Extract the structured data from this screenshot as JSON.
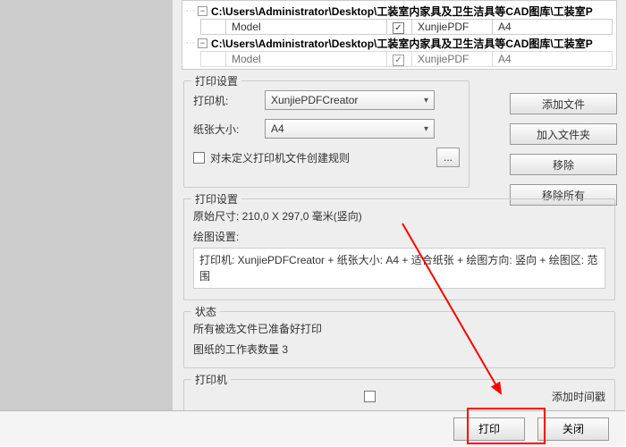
{
  "tree": {
    "path1": "C:\\Users\\Administrator\\Desktop\\工装室内家具及卫生洁具等CAD图库\\工装室P",
    "model": "Model",
    "pdfcol": "XunjiePDF",
    "paper": "A4",
    "path2": "C:\\Users\\Administrator\\Desktop\\工装室内家具及卫生洁具等CAD图库\\工装室P",
    "model2": "Model",
    "pdfcol2": "XunjiePDF",
    "paper2": "A4"
  },
  "printSettings": {
    "legend": "打印设置",
    "printerLabel": "打印机:",
    "printerValue": "XunjiePDFCreator",
    "sizeLabel": "纸张大小:",
    "sizeValue": "A4",
    "ruleCheck": "对未定义打印机文件创建规则",
    "moreBtn": "..."
  },
  "buttons": {
    "addFile": "添加文件",
    "addFolder": "加入文件夹",
    "remove": "移除",
    "removeAll": "移除所有"
  },
  "settings2": {
    "legend": "打印设置",
    "origSize": "原始尺寸: 210,0 X 297,0 毫米(竖向)",
    "plotLabel": "绘图设置:",
    "detail": "打印机: XunjiePDFCreator + 纸张大小: A4 + 适合纸张 + 绘图方向: 竖向 + 绘图区: 范围"
  },
  "status": {
    "legend": "状态",
    "line1": "所有被选文件已准备好打印",
    "line2": "图纸的工作表数量 3"
  },
  "printer": {
    "legend": "打印机",
    "timestamp": "添加时间戳"
  },
  "bottom": {
    "print": "打印",
    "close": "关闭"
  },
  "check": "✓"
}
